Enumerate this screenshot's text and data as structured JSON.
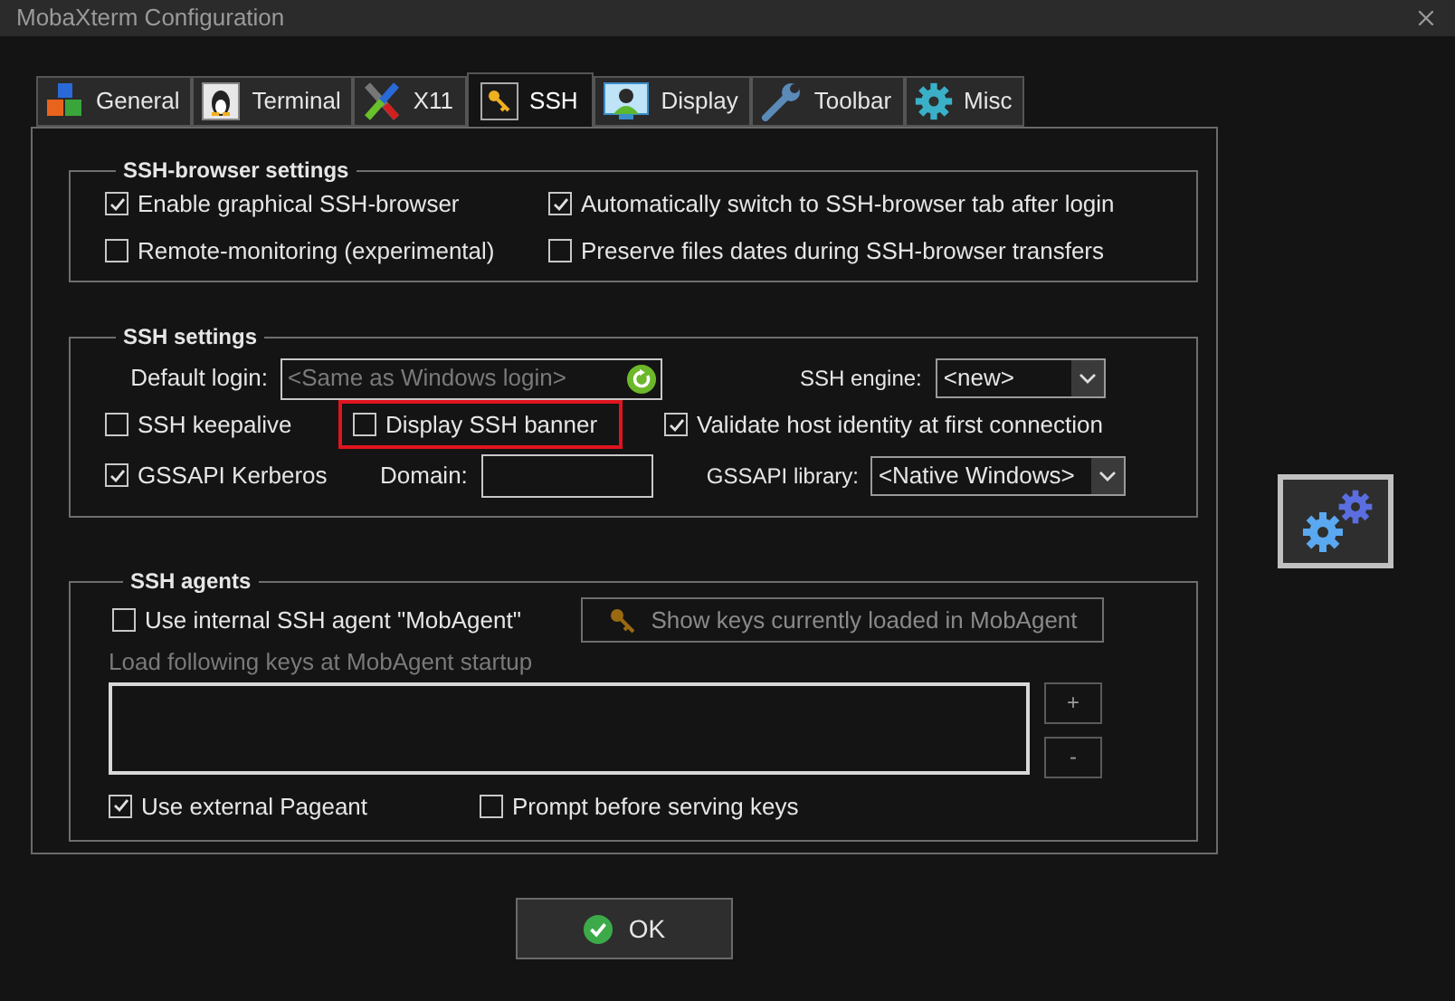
{
  "window": {
    "title": "MobaXterm Configuration"
  },
  "tabs": [
    {
      "label": "General",
      "selected": false
    },
    {
      "label": "Terminal",
      "selected": false
    },
    {
      "label": "X11",
      "selected": false
    },
    {
      "label": "SSH",
      "selected": true
    },
    {
      "label": "Display",
      "selected": false
    },
    {
      "label": "Toolbar",
      "selected": false
    },
    {
      "label": "Misc",
      "selected": false
    }
  ],
  "ssh_browser": {
    "title": "SSH-browser settings",
    "options": [
      {
        "label": "Enable graphical SSH-browser",
        "checked": true
      },
      {
        "label": "Automatically switch to SSH-browser tab after login",
        "checked": true
      },
      {
        "label": "Remote-monitoring (experimental)",
        "checked": false
      },
      {
        "label": "Preserve files dates during SSH-browser transfers",
        "checked": false
      }
    ]
  },
  "ssh_settings": {
    "title": "SSH settings",
    "default_login": {
      "label": "Default login:",
      "placeholder": "<Same as Windows login>"
    },
    "ssh_engine": {
      "label": "SSH engine:",
      "value": "<new>"
    },
    "options": [
      {
        "label": "SSH keepalive",
        "checked": false,
        "highlighted": false
      },
      {
        "label": "Display SSH banner",
        "checked": false,
        "highlighted": true
      },
      {
        "label": "Validate host identity at first connection",
        "checked": true,
        "highlighted": false
      }
    ],
    "gssapi": {
      "label": "GSSAPI Kerberos",
      "checked": true
    },
    "domain": {
      "label": "Domain:"
    },
    "gssapi_library": {
      "label": "GSSAPI library:",
      "value": "<Native Windows>"
    }
  },
  "ssh_agents": {
    "title": "SSH agents",
    "internal_agent": {
      "label": "Use internal SSH agent \"MobAgent\"",
      "checked": false
    },
    "show_keys_button": {
      "label": "Show keys currently loaded in MobAgent",
      "disabled": true
    },
    "keys_label": {
      "text": "Load following keys at MobAgent startup",
      "disabled": true
    },
    "add_button": "+",
    "remove_button": "-",
    "options": [
      {
        "label": "Use external Pageant",
        "checked": true
      },
      {
        "label": "Prompt before serving keys",
        "checked": false
      }
    ]
  },
  "ok_button": {
    "label": "OK"
  }
}
